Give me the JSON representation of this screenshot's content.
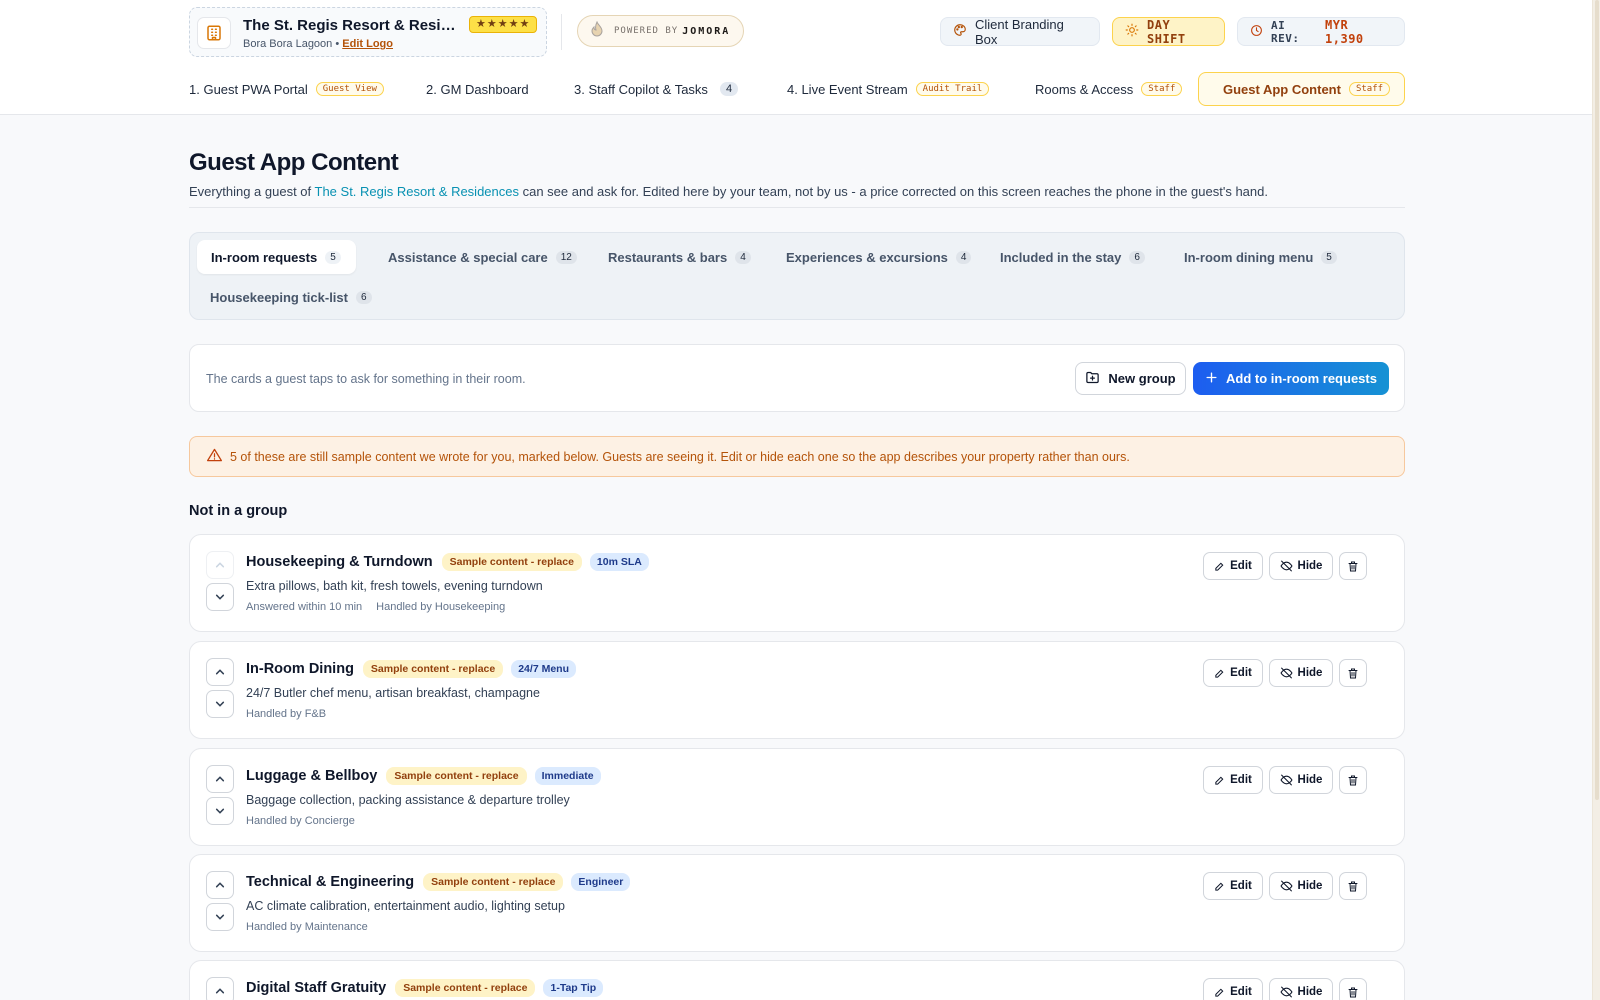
{
  "brand": {
    "name": "The St. Regis Resort & Residences",
    "stars": "★★★★★",
    "location": "Bora Bora Lagoon",
    "separator": "•",
    "edit_logo": "Edit Logo"
  },
  "powered_by": {
    "label": "POWERED BY",
    "brand": "JOMORA"
  },
  "header_buttons": {
    "branding": "Client Branding Box",
    "shift": "DAY SHIFT",
    "ai_rev_label": "AI REV:",
    "ai_rev_value": "MYR 1,390"
  },
  "nav": {
    "tabs": [
      {
        "label": "1. Guest PWA Portal",
        "tag": "Guest View"
      },
      {
        "label": "2. GM Dashboard"
      },
      {
        "label": "3. Staff Copilot & Tasks",
        "count": "4"
      },
      {
        "label": "4. Live Event Stream",
        "tag": "Audit Trail"
      },
      {
        "label": "Rooms & Access",
        "tag": "Staff"
      },
      {
        "label": "Guest App Content",
        "tag": "Staff"
      }
    ]
  },
  "page": {
    "title": "Guest App Content",
    "desc_prefix": "Everything a guest of ",
    "desc_hotel": "The St. Regis Resort & Residences",
    "desc_suffix": " can see and ask for. Edited here by your team, not by us - a price corrected on this screen reaches the phone in the guest's hand."
  },
  "categories": [
    {
      "label": "In-room requests",
      "count": "5"
    },
    {
      "label": "Assistance & special care",
      "count": "12"
    },
    {
      "label": "Restaurants & bars",
      "count": "4"
    },
    {
      "label": "Experiences & excursions",
      "count": "4"
    },
    {
      "label": "Included in the stay",
      "count": "6"
    },
    {
      "label": "In-room dining menu",
      "count": "5"
    },
    {
      "label": "Housekeeping tick-list",
      "count": "6"
    }
  ],
  "action_bar": {
    "hint": "The cards a guest taps to ask for something in their room.",
    "new_group": "New group",
    "add": "Add to in-room requests"
  },
  "alert": {
    "text": "5 of these are still sample content we wrote for you, marked below. Guests are seeing it. Edit or hide each one so the app describes your property rather than ours."
  },
  "section": {
    "title": "Not in a group"
  },
  "card_labels": {
    "sample": "Sample content - replace",
    "edit": "Edit",
    "hide": "Hide"
  },
  "cards": [
    {
      "name": "Housekeeping & Turndown",
      "tag": "10m SLA",
      "desc": "Extra pillows, bath kit, fresh towels, evening turndown",
      "meta1": "Answered within 10 min",
      "meta2": "Handled by Housekeeping"
    },
    {
      "name": "In-Room Dining",
      "tag": "24/7 Menu",
      "desc": "24/7 Butler chef menu, artisan breakfast, champagne",
      "meta1": "Handled by F&B"
    },
    {
      "name": "Luggage & Bellboy",
      "tag": "Immediate",
      "desc": "Baggage collection, packing assistance & departure trolley",
      "meta1": "Handled by Concierge"
    },
    {
      "name": "Technical & Engineering",
      "tag": "Engineer",
      "desc": "AC climate calibration, entertainment audio, lighting setup",
      "meta1": "Handled by Maintenance"
    },
    {
      "name": "Digital Staff Gratuity",
      "tag": "1-Tap Tip"
    }
  ]
}
